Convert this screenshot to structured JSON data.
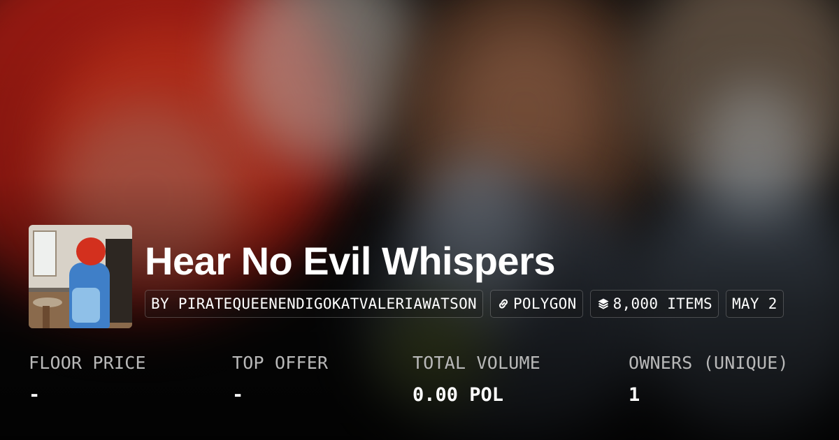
{
  "collection": {
    "title": "Hear No Evil Whispers",
    "creator": "BY PIRATEQUEENENDIGOKATVALERIAWATSON",
    "chain": "POLYGON",
    "items": "8,000 ITEMS",
    "date": "MAY 2",
    "chain_icon": "link-icon",
    "items_icon": "layers-icon"
  },
  "stats": [
    {
      "label": "FLOOR PRICE",
      "value": "-"
    },
    {
      "label": "TOP OFFER",
      "value": "-"
    },
    {
      "label": "TOTAL VOLUME",
      "value": "0.00 POL"
    },
    {
      "label": "OWNERS (UNIQUE)",
      "value": "1"
    }
  ]
}
